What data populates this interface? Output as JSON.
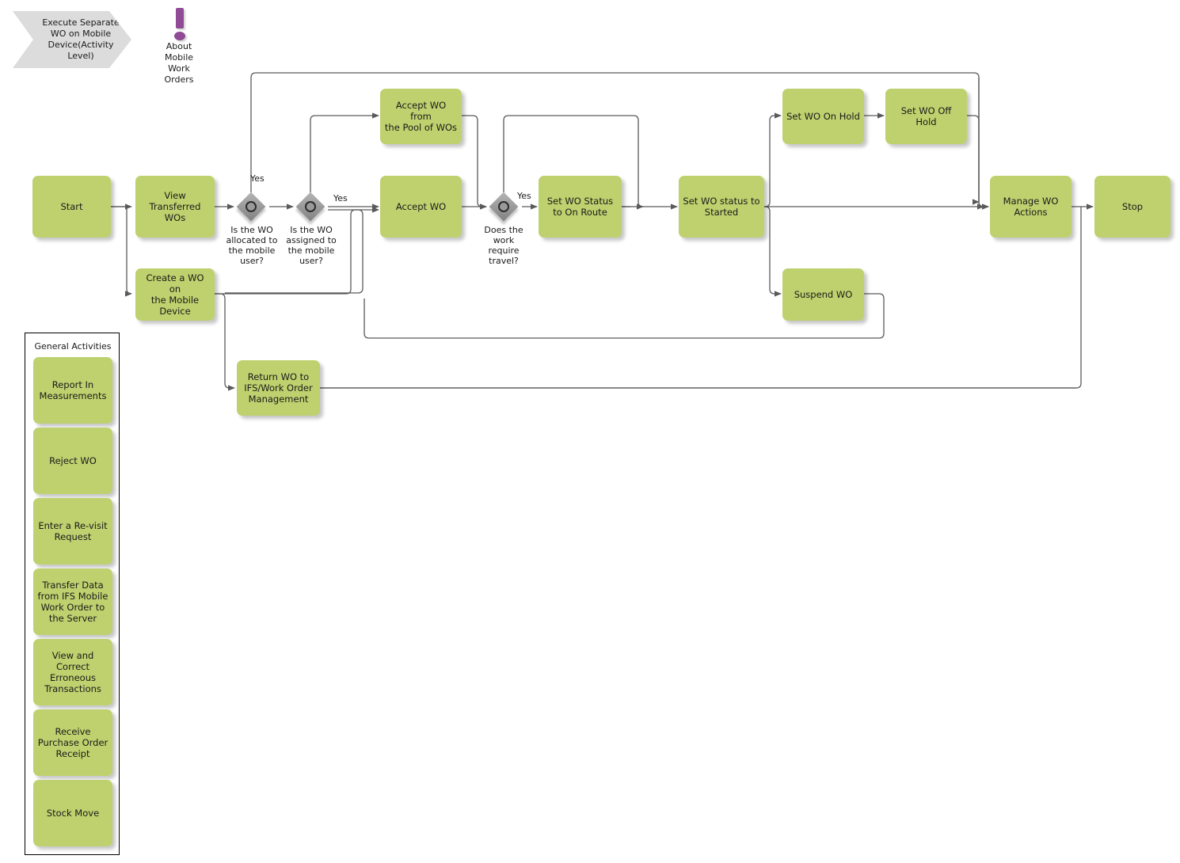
{
  "banner": {
    "title": "Execute Separate\nWO on Mobile\nDevice(Activity\nLevel)"
  },
  "info_icon": {
    "name": "exclamation-icon",
    "label": "About\nMobile Work\nOrders",
    "color": "#8f4b95"
  },
  "theme": {
    "node_fill": "#bed16e",
    "banner_fill": "#dcdcdc",
    "line_color": "#5a5a5a",
    "gateway_fill": "#9e9e9e"
  },
  "nodes": [
    {
      "id": "start",
      "label": "Start"
    },
    {
      "id": "view_transferred",
      "label": "View\nTransferred\nWOs"
    },
    {
      "id": "create_wo",
      "label": "Create a WO on\nthe Mobile\nDevice"
    },
    {
      "id": "accept_pool",
      "label": "Accept WO from\nthe Pool of WOs"
    },
    {
      "id": "accept_wo",
      "label": "Accept WO"
    },
    {
      "id": "set_on_route",
      "label": "Set WO Status\nto On Route"
    },
    {
      "id": "set_started",
      "label": "Set WO status to\nStarted"
    },
    {
      "id": "set_on_hold",
      "label": "Set WO On Hold"
    },
    {
      "id": "set_off_hold",
      "label": "Set WO Off Hold"
    },
    {
      "id": "suspend_wo",
      "label": "Suspend WO"
    },
    {
      "id": "manage_actions",
      "label": "Manage WO\nActions"
    },
    {
      "id": "stop",
      "label": "Stop"
    },
    {
      "id": "return_wo",
      "label": "Return WO to\nIFS/Work Order\nManagement"
    }
  ],
  "gateways": [
    {
      "id": "gw_allocated",
      "label": "Is the WO\nallocated to\nthe mobile\nuser?",
      "yes": "Yes"
    },
    {
      "id": "gw_assigned",
      "label": "Is the WO\nassigned to\nthe mobile\nuser?",
      "yes": "Yes"
    },
    {
      "id": "gw_travel",
      "label": "Does the\nwork\nrequire\ntravel?",
      "yes": "Yes"
    }
  ],
  "panel": {
    "title": "General Activities",
    "items": [
      {
        "id": "report_in_measurements",
        "label": "Report In\nMeasurements"
      },
      {
        "id": "reject_wo",
        "label": "Reject WO"
      },
      {
        "id": "enter_revisit",
        "label": "Enter a Re-visit\nRequest"
      },
      {
        "id": "transfer_data",
        "label": "Transfer Data\nfrom IFS Mobile\nWork Order to\nthe Server"
      },
      {
        "id": "view_correct",
        "label": "View and\nCorrect\nErroneous\nTransactions"
      },
      {
        "id": "receive_po_receipt",
        "label": "Receive\nPurchase Order\nReceipt"
      },
      {
        "id": "stock_move",
        "label": "Stock Move"
      }
    ]
  },
  "chart_data": {
    "type": "diagram",
    "title": "Execute Separate WO on Mobile Device(Activity Level)",
    "edges": [
      {
        "from": "start",
        "to": "view_transferred"
      },
      {
        "from": "start",
        "to": "create_wo"
      },
      {
        "from": "view_transferred",
        "to": "gw_allocated"
      },
      {
        "from": "gw_allocated",
        "to": "gw_assigned"
      },
      {
        "from": "gw_allocated",
        "to": "manage_actions",
        "label": "Yes"
      },
      {
        "from": "gw_assigned",
        "to": "accept_wo",
        "label": "Yes"
      },
      {
        "from": "gw_assigned",
        "to": "accept_pool"
      },
      {
        "from": "create_wo",
        "to": "gw_travel"
      },
      {
        "from": "create_wo",
        "to": "return_wo"
      },
      {
        "from": "accept_pool",
        "to": "gw_travel"
      },
      {
        "from": "accept_wo",
        "to": "gw_travel"
      },
      {
        "from": "gw_travel",
        "to": "set_on_route",
        "label": "Yes"
      },
      {
        "from": "gw_travel",
        "to": "set_started"
      },
      {
        "from": "set_on_route",
        "to": "set_started"
      },
      {
        "from": "set_started",
        "to": "set_on_hold"
      },
      {
        "from": "set_started",
        "to": "suspend_wo"
      },
      {
        "from": "set_started",
        "to": "manage_actions"
      },
      {
        "from": "set_on_hold",
        "to": "set_off_hold"
      },
      {
        "from": "set_off_hold",
        "to": "manage_actions"
      },
      {
        "from": "suspend_wo",
        "to": "accept_wo"
      },
      {
        "from": "manage_actions",
        "to": "stop"
      },
      {
        "from": "manage_actions",
        "to": "return_wo"
      },
      {
        "from": "return_wo",
        "to": "stop"
      }
    ]
  }
}
